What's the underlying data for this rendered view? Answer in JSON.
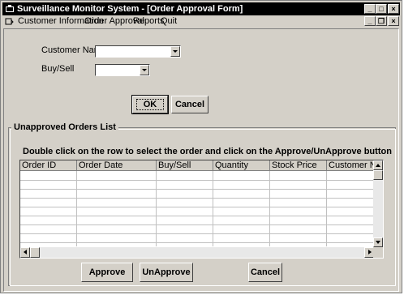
{
  "window": {
    "title": "Surveillance Monitor System - [Order Approval Form]",
    "minimize": "_",
    "maximize": "□",
    "close": "×",
    "child_minimize": "_",
    "child_restore": "❐",
    "child_close": "×"
  },
  "menu": {
    "items": [
      {
        "label": "Customer Information",
        "accel": "C"
      },
      {
        "label": "Order Approval",
        "accel": "O"
      },
      {
        "label": "Reports",
        "accel": "R"
      },
      {
        "label": "Quit",
        "accel": "Q"
      }
    ]
  },
  "filters": {
    "customer_name_label": "Customer Name",
    "customer_name_value": "",
    "buysell_label": "Buy/Sell",
    "buysell_value": ""
  },
  "buttons": {
    "ok": "OK",
    "cancel": "Cancel",
    "approve": "Approve",
    "unapprove": "UnApprove",
    "cancel_bottom": "Cancel"
  },
  "orders": {
    "group_title": "Unapproved Orders List",
    "instruction": "Double click on the row to select the order and click on the Approve/UnApprove button",
    "columns": [
      "Order ID",
      "Order Date",
      "Buy/Sell",
      "Quantity",
      "Stock Price",
      "Customer Name"
    ],
    "rows": []
  }
}
